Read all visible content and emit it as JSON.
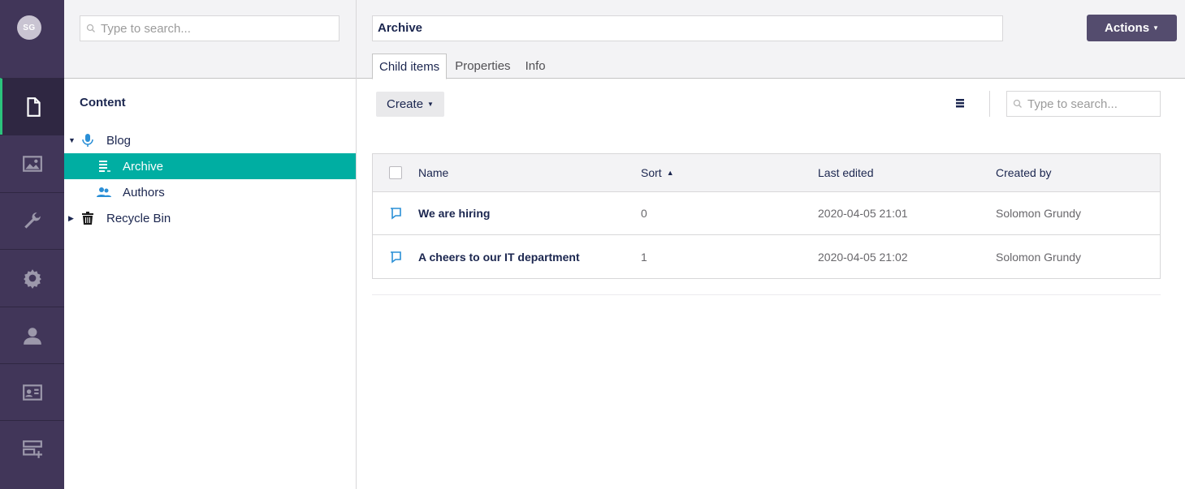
{
  "user": {
    "initials": "SG"
  },
  "rail": {
    "items": [
      {
        "icon": "document-icon",
        "active": true
      },
      {
        "icon": "image-icon",
        "active": false
      },
      {
        "icon": "wrench-icon",
        "active": false
      },
      {
        "icon": "gear-icon",
        "active": false
      },
      {
        "icon": "user-icon",
        "active": false
      },
      {
        "icon": "id-card-icon",
        "active": false
      },
      {
        "icon": "form-add-icon",
        "active": false
      }
    ]
  },
  "tree": {
    "search_placeholder": "Type to search...",
    "title": "Content",
    "items": [
      {
        "label": "Blog",
        "icon": "microphone-icon",
        "expanded": true
      },
      {
        "label": "Archive",
        "icon": "list-icon",
        "selected": true
      },
      {
        "label": "Authors",
        "icon": "users-icon"
      },
      {
        "label": "Recycle Bin",
        "icon": "trash-icon",
        "expanded": false
      }
    ]
  },
  "editor": {
    "name_value": "Archive",
    "actions_label": "Actions",
    "tabs": [
      {
        "label": "Child items",
        "active": true
      },
      {
        "label": "Properties",
        "active": false
      },
      {
        "label": "Info",
        "active": false
      }
    ],
    "create_label": "Create",
    "search_placeholder": "Type to search..."
  },
  "table": {
    "columns": [
      "Name",
      "Sort",
      "Last edited",
      "Created by"
    ],
    "sort_column": "Sort",
    "rows": [
      {
        "name": "We are hiring",
        "sort": "0",
        "last_edited": "2020-04-05 21:01",
        "created_by": "Solomon Grundy"
      },
      {
        "name": "A cheers to our IT department",
        "sort": "1",
        "last_edited": "2020-04-05 21:02",
        "created_by": "Solomon Grundy"
      }
    ]
  },
  "colors": {
    "rail": "#413659",
    "selected": "#00aea2",
    "accent_green": "#2bc37c",
    "actions_button": "#544c6e",
    "icon_blue": "#2152a3"
  }
}
